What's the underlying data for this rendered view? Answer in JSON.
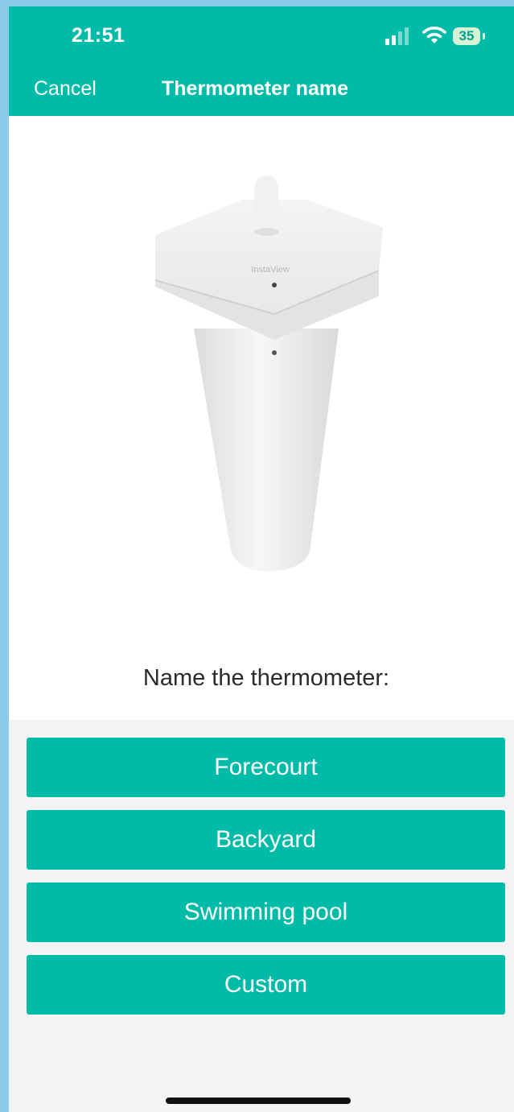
{
  "status_bar": {
    "time": "21:51",
    "battery": "35",
    "icons": [
      "signal-icon",
      "wifi-icon",
      "battery-icon"
    ]
  },
  "header": {
    "cancel_label": "Cancel",
    "title": "Thermometer name",
    "background_color": "#00bba7"
  },
  "product": {
    "brand_label": "InstaView"
  },
  "prompt": "Name the thermometer:",
  "options": [
    {
      "label": "Forecourt"
    },
    {
      "label": "Backyard"
    },
    {
      "label": "Swimming pool"
    },
    {
      "label": "Custom"
    }
  ],
  "colors": {
    "accent": "#00bba7",
    "button_text": "#ffffff"
  }
}
